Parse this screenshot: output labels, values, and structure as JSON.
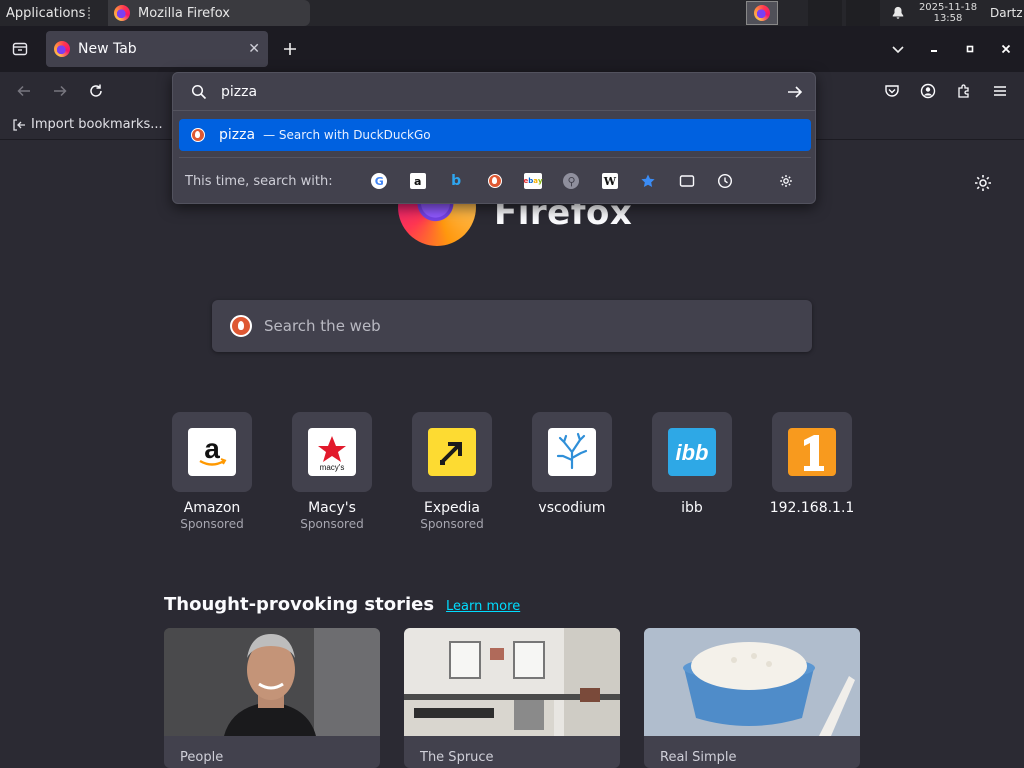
{
  "system_panel": {
    "applications_label": "Applications",
    "task_title": "Mozilla Firefox",
    "clock_date": "2025-11-18",
    "clock_time": "13:58",
    "user": "Dartz"
  },
  "tabs": [
    {
      "title": "New Tab"
    }
  ],
  "bookmarks_bar": {
    "import_label": "Import bookmarks..."
  },
  "url_dropdown": {
    "query": "pizza",
    "result": {
      "term": "pizza",
      "description": "— Search with DuckDuckGo"
    },
    "oneoff_label": "This time, search with:",
    "engines": [
      "google-icon",
      "amazon-icon",
      "bing-icon",
      "duckduckgo-icon",
      "ebay-icon",
      "search-engine-icon",
      "wikipedia-icon",
      "bookmarks-star-icon",
      "tabs-icon",
      "history-icon",
      "search-settings-gear-icon"
    ]
  },
  "newtab": {
    "brand": "Firefox",
    "search_placeholder": "Search the web",
    "shortcuts": [
      {
        "label": "Amazon",
        "sponsored": "Sponsored"
      },
      {
        "label": "Macy's",
        "sponsored": "Sponsored"
      },
      {
        "label": "Expedia",
        "sponsored": "Sponsored"
      },
      {
        "label": "vscodium",
        "sponsored": ""
      },
      {
        "label": "ibb",
        "sponsored": ""
      },
      {
        "label": "192.168.1.1",
        "sponsored": ""
      }
    ],
    "stories": {
      "title": "Thought-provoking stories",
      "learn_more": "Learn more",
      "cards": [
        {
          "source": "People"
        },
        {
          "source": "The Spruce"
        },
        {
          "source": "Real Simple"
        }
      ]
    }
  },
  "colors": {
    "accent": "#0061e0",
    "link": "#00ddff",
    "page_bg": "#2b2a33",
    "tile_bg": "#42414d"
  }
}
